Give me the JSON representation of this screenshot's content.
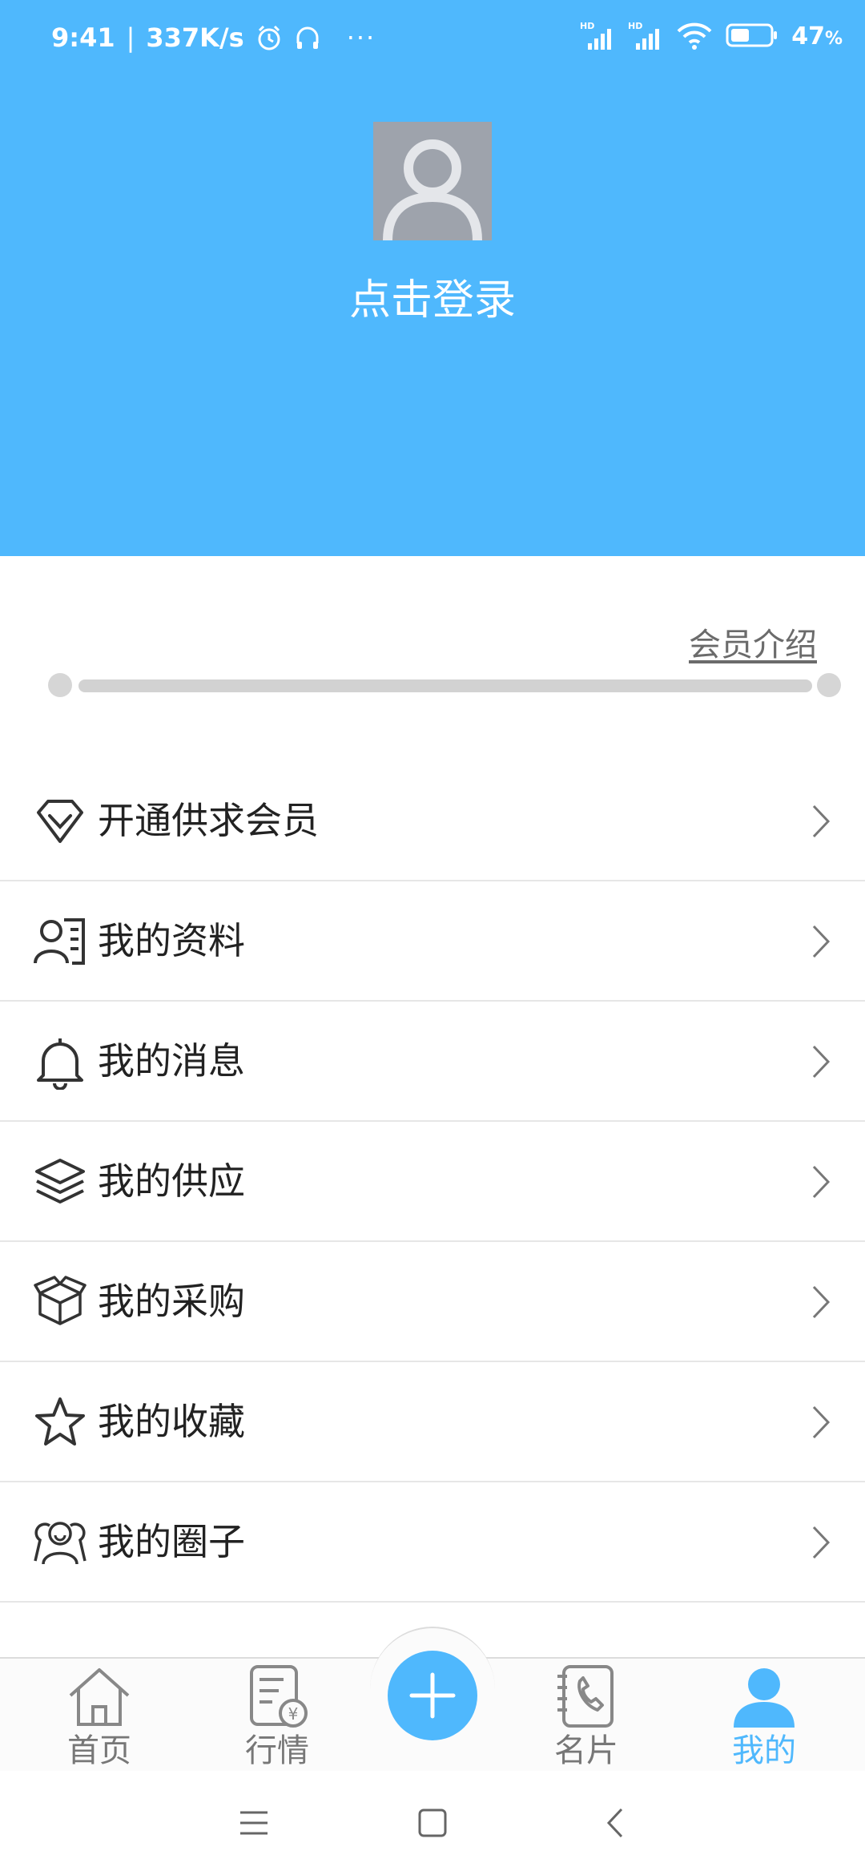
{
  "status_bar": {
    "time": "9:41",
    "speed": "337K/s",
    "battery_percent": "47",
    "battery_unit": "%",
    "more": "···"
  },
  "profile": {
    "login_label": "点击登录"
  },
  "member": {
    "intro_link": "会员介绍",
    "progress": 0
  },
  "menu": {
    "items": [
      {
        "label": "开通供求会员",
        "icon": "diamond-icon"
      },
      {
        "label": "我的资料",
        "icon": "profile-card-icon"
      },
      {
        "label": "我的消息",
        "icon": "bell-icon"
      },
      {
        "label": "我的供应",
        "icon": "layers-icon"
      },
      {
        "label": "我的采购",
        "icon": "box-icon"
      },
      {
        "label": "我的收藏",
        "icon": "star-icon"
      },
      {
        "label": "我的圈子",
        "icon": "group-icon"
      }
    ]
  },
  "tabbar": {
    "tabs": [
      {
        "label": "首页",
        "icon": "home-icon",
        "active": false
      },
      {
        "label": "行情",
        "icon": "market-icon",
        "active": false
      },
      {
        "label": "名片",
        "icon": "business-card-icon",
        "active": false
      },
      {
        "label": "我的",
        "icon": "user-icon",
        "active": true
      }
    ],
    "center_icon": "plus-icon"
  },
  "colors": {
    "accent": "#4fb8fd",
    "avatar_bg": "#9ea3ac",
    "text": "#222222",
    "muted": "#777777"
  }
}
